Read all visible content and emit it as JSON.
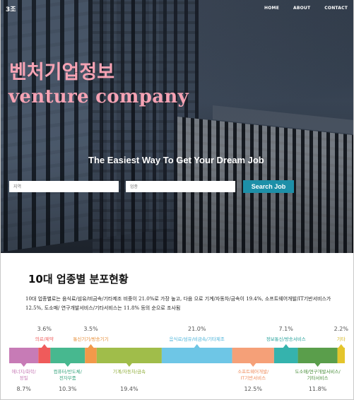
{
  "header": {
    "logo": "3조",
    "nav": [
      {
        "label": "HOME"
      },
      {
        "label": "ABOUT"
      },
      {
        "label": "CONTACT"
      }
    ]
  },
  "hero": {
    "title_ko": "벤처기업정보",
    "title_en": "venture company",
    "tagline": "The Easiest Way To Get Your Dream Job",
    "title_color": "#f6a3b4"
  },
  "search": {
    "region_placeholder": "지역",
    "industry_placeholder": "업종",
    "button_label": "Search Job",
    "button_color": "#1d8fa8"
  },
  "section": {
    "title": "10대 업종별 분포현황",
    "description": "10대 업종별로는 음식료/섬유/비금속/기타제조 비중이 21.0%로 가장 높고, 다음 으로 기계/자동차/금속이 19.4%, 소프트웨어개발/IT기반서비스가 12.5%, 도소매/ 연구개발서비스/기타서비스는 11.8% 등의 순으로 조사됨"
  },
  "chart_data": {
    "type": "bar",
    "orientation": "stacked-horizontal",
    "unit": "%",
    "segments": [
      {
        "label": "에너지/화학/\n정밀",
        "value": 8.7,
        "value_text": "8.7%",
        "color": "#c77bb6",
        "label_color": "#c77bb6",
        "pos": "below"
      },
      {
        "label": "의료/제약",
        "value": 3.6,
        "value_text": "3.6%",
        "color": "#ef5b5b",
        "label_color": "#ef5b5b",
        "pos": "above"
      },
      {
        "label": "컴퓨터/반도체/\n전자부품",
        "value": 10.3,
        "value_text": "10.3%",
        "color": "#47b88f",
        "label_color": "#3aa57f",
        "pos": "below"
      },
      {
        "label": "통신기기/방송기기",
        "value": 3.5,
        "value_text": "3.5%",
        "color": "#f2994a",
        "label_color": "#e58a32",
        "pos": "above"
      },
      {
        "label": "기계/자동차/금속",
        "value": 19.4,
        "value_text": "19.4%",
        "color": "#a0bd4a",
        "label_color": "#8fad3a",
        "pos": "below"
      },
      {
        "label": "음식료/섬유/비금속/기타제조",
        "value": 21.0,
        "value_text": "21.0%",
        "color": "#6ec6e6",
        "label_color": "#4bb3d9",
        "pos": "above"
      },
      {
        "label": "소프트웨어개발/\nIT기반서비스",
        "value": 12.5,
        "value_text": "12.5%",
        "color": "#f5a078",
        "label_color": "#ee8a5a",
        "pos": "below"
      },
      {
        "label": "정보통신/방송서비스",
        "value": 7.1,
        "value_text": "7.1%",
        "color": "#35b3ad",
        "label_color": "#2aa39d",
        "pos": "above"
      },
      {
        "label": "도소매/연구개발서비스/\n기타서비스",
        "value": 11.8,
        "value_text": "11.8%",
        "color": "#5a9e4b",
        "label_color": "#4a8e3b",
        "pos": "below"
      },
      {
        "label": "기타",
        "value": 2.2,
        "value_text": "2.2%",
        "color": "#e4c52c",
        "label_color": "#d4b51c",
        "pos": "above"
      }
    ]
  }
}
